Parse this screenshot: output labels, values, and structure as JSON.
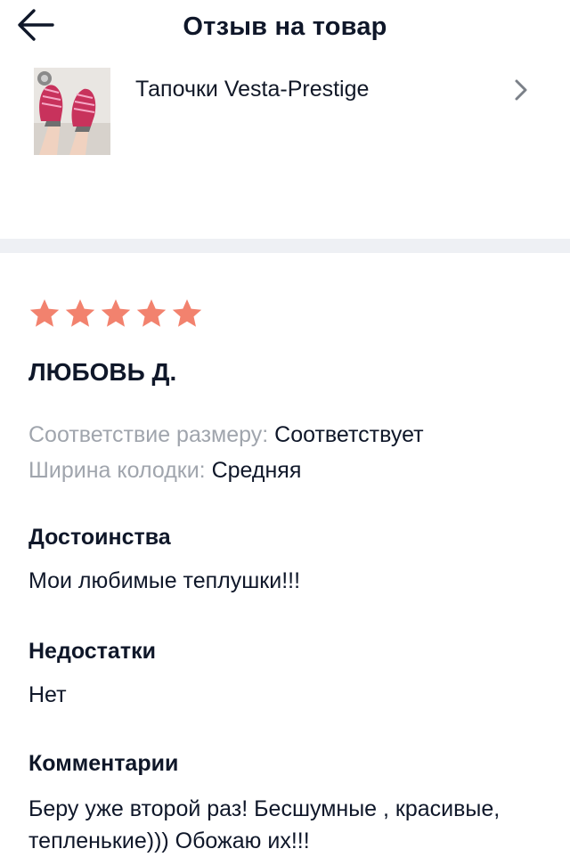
{
  "header": {
    "title": "Отзыв на товар",
    "back_icon": "arrow-left-icon"
  },
  "product": {
    "name": "Тапочки Vesta-Prestige",
    "chevron_icon": "chevron-right-icon"
  },
  "review": {
    "rating": 5,
    "rating_max": 5,
    "star_color": "#f2826e",
    "author": "ЛЮБОВЬ Д.",
    "attributes": [
      {
        "label": "Соответствие размеру:",
        "value": "Соответствует"
      },
      {
        "label": "Ширина колодки:",
        "value": "Средняя"
      }
    ],
    "pros_title": "Достоинства",
    "pros_text": "Мои любимые теплушки!!!",
    "cons_title": "Недостатки",
    "cons_text": "Нет",
    "comment_title": "Комментарии",
    "comment_text": "Беру уже второй раз! Бесшумные , красивые, тепленькие))) Обожаю их!!!"
  }
}
